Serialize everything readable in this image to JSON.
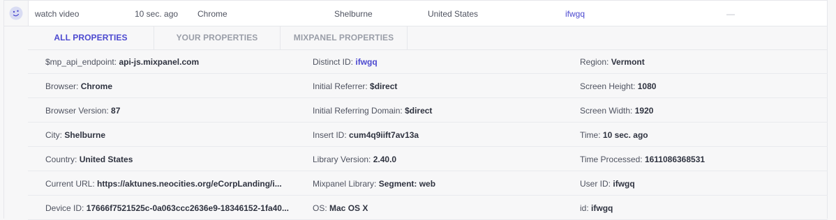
{
  "event_row": {
    "event": "watch video",
    "time": "10 sec. ago",
    "browser": "Chrome",
    "city": "Shelburne",
    "country": "United States",
    "user": "ifwgq",
    "extra": "—"
  },
  "tabs": [
    {
      "label": "ALL PROPERTIES",
      "active": true
    },
    {
      "label": "YOUR PROPERTIES",
      "active": false
    },
    {
      "label": "MIXPANEL PROPERTIES",
      "active": false
    }
  ],
  "properties": [
    [
      {
        "key": "$mp_api_endpoint:",
        "value": "api-js.mixpanel.com"
      },
      {
        "key": "Distinct ID:",
        "value": "ifwgq"
      },
      {
        "key": "Region:",
        "value": "Vermont"
      }
    ],
    [
      {
        "key": "Browser:",
        "value": "Chrome"
      },
      {
        "key": "Initial Referrer:",
        "value": "$direct"
      },
      {
        "key": "Screen Height:",
        "value": "1080"
      }
    ],
    [
      {
        "key": "Browser Version:",
        "value": "87"
      },
      {
        "key": "Initial Referring Domain:",
        "value": "$direct"
      },
      {
        "key": "Screen Width:",
        "value": "1920"
      }
    ],
    [
      {
        "key": "City:",
        "value": "Shelburne"
      },
      {
        "key": "Insert ID:",
        "value": "cum4q9iift7av13a"
      },
      {
        "key": "Time:",
        "value": "10 sec. ago"
      }
    ],
    [
      {
        "key": "Country:",
        "value": "United States"
      },
      {
        "key": "Library Version:",
        "value": "2.40.0"
      },
      {
        "key": "Time Processed:",
        "value": "1611086368531"
      }
    ],
    [
      {
        "key": "Current URL:",
        "value": "https://aktunes.neocities.org/eCorpLanding/i..."
      },
      {
        "key": "Mixpanel Library:",
        "value": "Segment: web"
      },
      {
        "key": "User ID:",
        "value": "ifwgq"
      }
    ],
    [
      {
        "key": "Device ID:",
        "value": "17666f7521525c-0a063ccc2636e9-18346152-1fa40..."
      },
      {
        "key": "OS:",
        "value": "Mac OS X"
      },
      {
        "key": "id:",
        "value": "ifwgq"
      }
    ]
  ],
  "colors": {
    "accent": "#4c49d0",
    "background": "#f7f7f8",
    "border": "#e6e7eb"
  },
  "icons": {
    "avatar": "smiley-avatar-icon"
  }
}
